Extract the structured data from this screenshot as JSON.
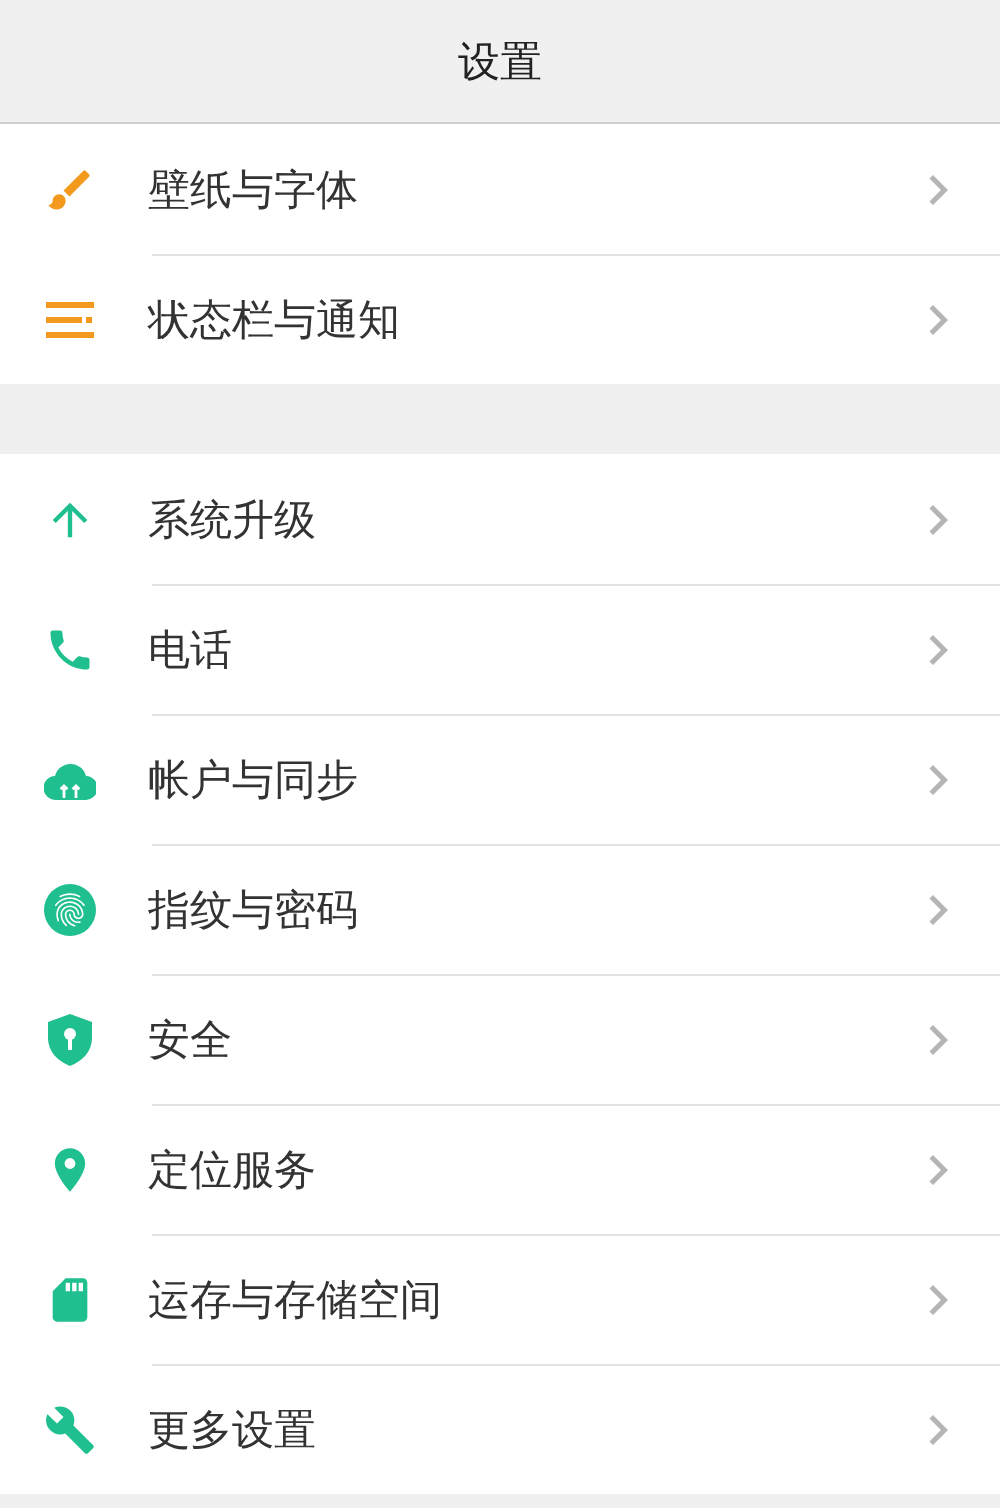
{
  "header": {
    "title": "设置"
  },
  "groups": [
    {
      "items": [
        {
          "label": "壁纸与字体",
          "kind": "brush",
          "color": "#f39a1e"
        },
        {
          "label": "状态栏与通知",
          "kind": "list",
          "color": "#f39a1e"
        }
      ]
    },
    {
      "items": [
        {
          "label": "系统升级",
          "kind": "arrow-up",
          "color": "#1fbf8f"
        },
        {
          "label": "电话",
          "kind": "phone",
          "color": "#1fbf8f"
        },
        {
          "label": "帐户与同步",
          "kind": "cloud",
          "color": "#1fbf8f"
        },
        {
          "label": "指纹与密码",
          "kind": "fingerprint",
          "color": "#1fbf8f"
        },
        {
          "label": "安全",
          "kind": "shield",
          "color": "#1fbf8f"
        },
        {
          "label": "定位服务",
          "kind": "pin",
          "color": "#1fbf8f"
        },
        {
          "label": "运存与存储空间",
          "kind": "sd-card",
          "color": "#1fbf8f"
        },
        {
          "label": "更多设置",
          "kind": "wrench",
          "color": "#1fbf8f"
        }
      ]
    }
  ]
}
